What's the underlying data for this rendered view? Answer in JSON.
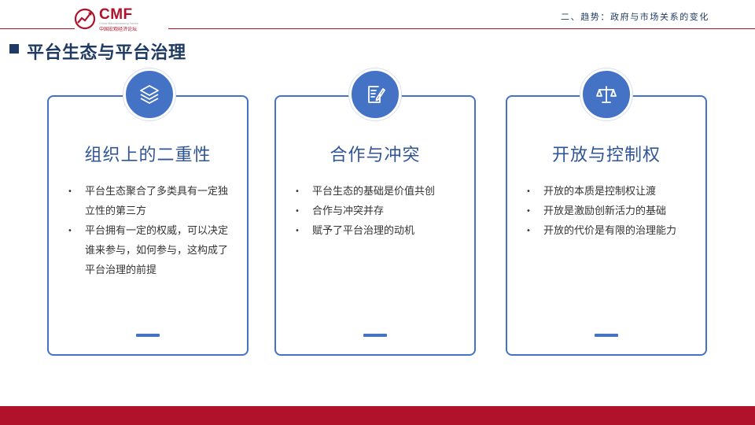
{
  "header": {
    "logo_text": "CMF",
    "logo_subtitle_en": "China Macroeconomy Forum",
    "logo_subtitle_cn": "中国宏观经济论坛",
    "section_label": "二、趋势：政府与市场关系的变化"
  },
  "page_title": "平台生态与平台治理",
  "colors": {
    "brand_red": "#b0122b",
    "navy": "#1f3b63",
    "accent_blue": "#4472c4",
    "card_title_blue": "#2f5597"
  },
  "cards": [
    {
      "icon": "layers-icon",
      "title": "组织上的二重性",
      "bullets": [
        "平台生态聚合了多类具有一定独立性的第三方",
        "平台拥有一定的权威，可以决定谁来参与，如何参与，这构成了平台治理的前提"
      ]
    },
    {
      "icon": "document-edit-icon",
      "title": "合作与冲突",
      "bullets": [
        "平台生态的基础是价值共创",
        "合作与冲突并存",
        "赋予了平台治理的动机"
      ]
    },
    {
      "icon": "scales-icon",
      "title": "开放与控制权",
      "bullets": [
        "开放的本质是控制权让渡",
        "开放是激励创新活力的基础",
        "开放的代价是有限的治理能力"
      ]
    }
  ]
}
